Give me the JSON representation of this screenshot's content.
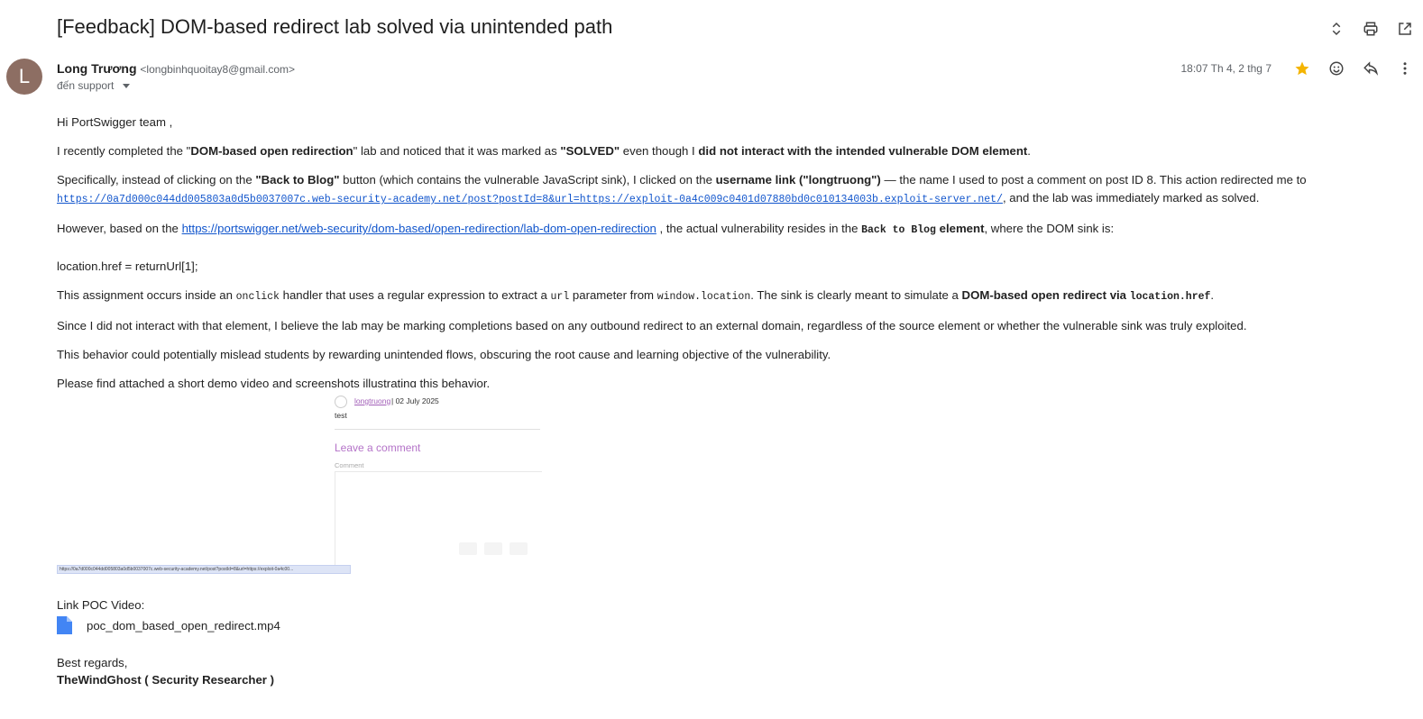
{
  "email": {
    "subject": "[Feedback] DOM-based redirect lab solved via unintended path",
    "avatar_letter": "L",
    "avatar_color": "#8d6e63",
    "sender_name": "Long Trương",
    "sender_email": "<longbinhquoitay8@gmail.com>",
    "recipient": "đến support",
    "date": "18:07 Th 4, 2 thg 7",
    "star_color": "#f4b400"
  },
  "icons": {
    "expand": "unfold-icon",
    "print": "print-icon",
    "open_new": "open-in-new-icon",
    "star": "star-icon",
    "emoji": "emoji-icon",
    "reply": "reply-icon",
    "more": "more-vert-icon",
    "attachment": "file-icon"
  },
  "body": {
    "greeting": "Hi PortSwigger team ,",
    "p1": {
      "a": "I recently completed the \"",
      "b1": "DOM-based open redirection",
      "c": "\" lab and noticed that it was marked as ",
      "b2": "\"SOLVED\"",
      "d": " even though I ",
      "b3": "did not interact with the intended vulnerable DOM element",
      "e": "."
    },
    "p2": {
      "a": "Specifically, instead of clicking on the ",
      "b1": "\"Back to Blog\"",
      "c": " button (which contains the vulnerable JavaScript sink), I clicked on the ",
      "b2": "username link (\"longtruong\")",
      "d": " — the name I used to post a comment on post ID 8. This action redirected me to ",
      "url": "https://0a7d000c044dd005803a0d5b0037007c.web-security-academy.net/post?postId=8&url=https://exploit-0a4c009c0401d07880bd0c010134003b.exploit-server.net/",
      "e": ", and the lab was immediately marked as solved."
    },
    "p3": {
      "a": "However, based on the ",
      "url": "https://portswigger.net/web-security/dom-based/open-redirection/lab-dom-open-redirection",
      "b": " , the actual vulnerability resides in the ",
      "code": "Back to Blog",
      "bold": " element",
      "c": ", where the DOM sink is:"
    },
    "code_line": "location.href = returnUrl[1];",
    "p4": {
      "a": "This assignment occurs inside an ",
      "code1": "onclick",
      "b": " handler that uses a regular expression to extract a ",
      "code2": "url",
      "c": " parameter from ",
      "code3": "window.location",
      "d": ". The sink is clearly meant to simulate a ",
      "bold": "DOM-based open redirect via ",
      "code4": "location.href",
      "e": "."
    },
    "p5": "Since I did not interact with that element, I believe the lab may be marking completions based on any outbound redirect to an external domain, regardless of the source element or whether the vulnerable sink was truly exploited.",
    "p6": "This behavior could potentially mislead students by rewarding unintended flows, obscuring the root cause and learning objective of the vulnerability.",
    "p7": "Please find attached a short demo video and screenshots illustrating this behavior."
  },
  "screenshot": {
    "username": "longtruong",
    "date": "| 02 July 2025",
    "comment_text": "test",
    "leave_comment": "Leave a comment",
    "comment_label": "Comment",
    "status_url": "https://0a7d000c044dd005803a0d5b0037007c.web-security-academy.net/post?postId=8&url=https://exploit-0a4c00..."
  },
  "attachment": {
    "label": "Link POC Video:",
    "file_name": "poc_dom_based_open_redirect.mp4",
    "icon_color": "#4285f4"
  },
  "signature": {
    "signoff": "Best regards,",
    "name": "TheWindGhost ( Security Researcher )"
  }
}
